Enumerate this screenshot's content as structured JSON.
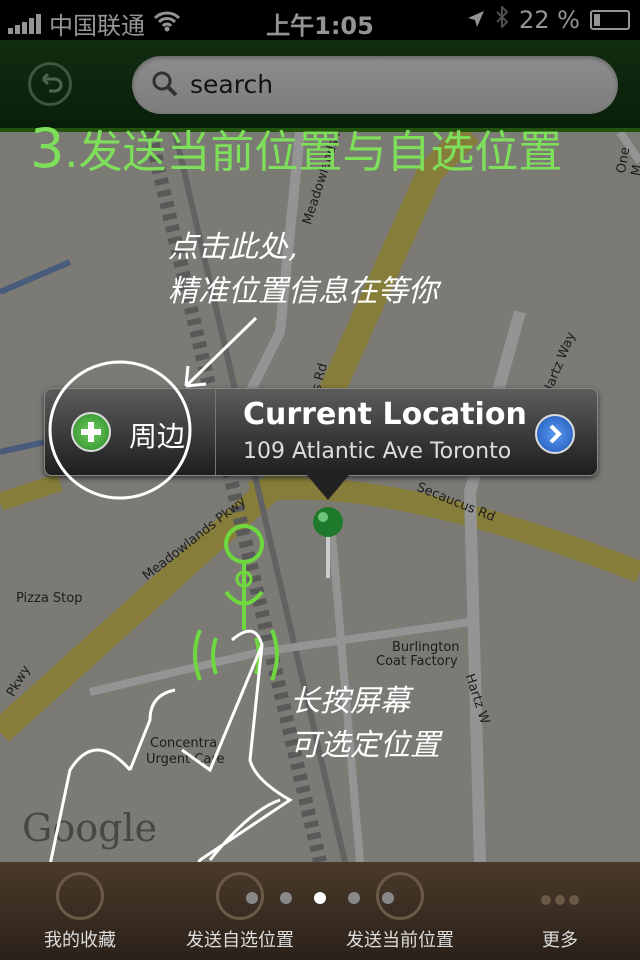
{
  "status": {
    "carrier": "中国联通",
    "time": "上午1:05",
    "battery": "22 %"
  },
  "search": {
    "placeholder": "search"
  },
  "map": {
    "labels": {
      "meadowlands_upper": "Meadowlands Pkwy",
      "meadowlands_lower": "Meadowlands Pkwy",
      "secaucus_rd": "Secaucus Rd",
      "secaucus_rd2": "Secaucus Rd",
      "hartz_way": "Hartz Way",
      "hartz_way2": "Hartz W",
      "pizza": "Pizza Stop",
      "burlington": "Burlington",
      "coat_factory": "Coat Factory",
      "concentra": "Concentra",
      "urgent_care": "Urgent Care",
      "pkwy": "Pkwy",
      "one_meadowlands": "One M"
    },
    "google": "Google"
  },
  "overlay": {
    "headline_num": "3",
    "headline_text": ".发送当前位置与自选位置",
    "tap_hint_line1": "点击此处,",
    "tap_hint_line2": "精准位置信息在等你",
    "press_hint_line1": "长按屏幕",
    "press_hint_line2": "可选定位置"
  },
  "callout": {
    "nearby": "周边",
    "title": "Current Location",
    "address": "109 Atlantic Ave Toronto"
  },
  "tabs": {
    "favorites": "我的收藏",
    "send_custom": "发送自选位置",
    "send_current": "发送当前位置",
    "more": "更多"
  },
  "page_indicator": {
    "count": 5,
    "active": 3
  }
}
